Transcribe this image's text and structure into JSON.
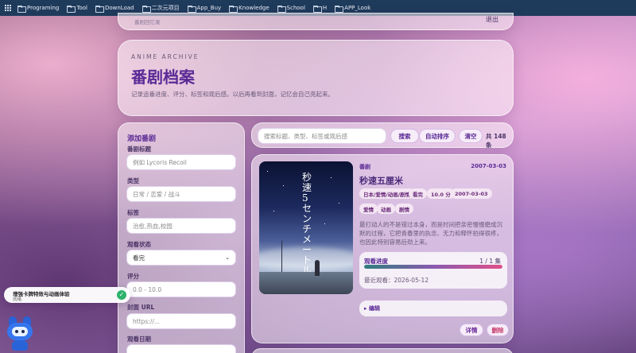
{
  "bookmarks": [
    {
      "label": "Programing"
    },
    {
      "label": "Tool"
    },
    {
      "label": "DownLoad"
    },
    {
      "label": "二次元项目"
    },
    {
      "label": "App_Buy"
    },
    {
      "label": "Knowledge"
    },
    {
      "label": "School"
    },
    {
      "label": "H"
    },
    {
      "label": "APP_Look"
    }
  ],
  "top": {
    "subtitle": "番剧回忆录",
    "logout": "退出"
  },
  "header": {
    "eyebrow": "ANIME ARCHIVE",
    "title": "番剧档案",
    "description": "记录追番进度、评分、标签和观后感。以后再看到封面，记忆会自己亮起来。"
  },
  "form": {
    "title": "添加番剧",
    "fields": [
      {
        "label": "番剧标题",
        "placeholder": "例如 Lycoris Recoil"
      },
      {
        "label": "类型",
        "placeholder": "日常 / 恋爱 / 战斗"
      },
      {
        "label": "标签",
        "placeholder": "治愈,热血,校园"
      },
      {
        "label": "观看状态",
        "value": "看完"
      },
      {
        "label": "评分",
        "placeholder": "0.0 - 10.0"
      },
      {
        "label": "封面 URL",
        "placeholder": "https://..."
      },
      {
        "label": "观看日期",
        "placeholder": ""
      }
    ]
  },
  "toolbar": {
    "search_placeholder": "搜索标题、类型、标签或观后感",
    "search_button": "搜索",
    "auto_sort": "自动排序",
    "clear": "清空",
    "count": "共 148 条"
  },
  "card": {
    "poster_text": "秒速5センチメートル",
    "category": "番剧",
    "date": "2007-03-03",
    "title": "秒速五厘米",
    "tags_row1": [
      "日本/爱情/动画/剧情",
      "看完",
      "10.0 分",
      "2007-03-03"
    ],
    "tags_row2": [
      "爱情",
      "动画",
      "剧情"
    ],
    "description": "最打动人的不是错过本身，而是时间把亲密慢慢磨成沉默的过程，它把青春里的执念、无力和释怀拍得很疼，也因此特别容易后劲上来。",
    "progress": {
      "label": "观看进度",
      "count": "1 / 1 集",
      "fraction": 1.0,
      "last_watched": "最近观看：2026-05-12"
    },
    "edit": "▸ 编辑",
    "details": "详情",
    "delete": "删除"
  },
  "toast": {
    "title": "增强卡牌特效与动画体验",
    "status": "就绪"
  }
}
